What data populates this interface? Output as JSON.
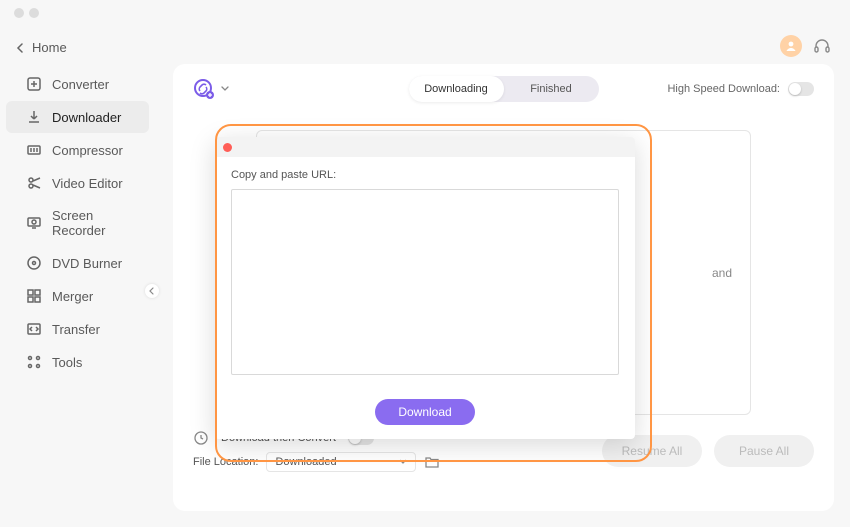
{
  "sidebar": {
    "home_label": "Home",
    "items": [
      {
        "label": "Converter"
      },
      {
        "label": "Downloader"
      },
      {
        "label": "Compressor"
      },
      {
        "label": "Video Editor"
      },
      {
        "label": "Screen Recorder"
      },
      {
        "label": "DVD Burner"
      },
      {
        "label": "Merger"
      },
      {
        "label": "Transfer"
      },
      {
        "label": "Tools"
      }
    ]
  },
  "tabs": {
    "downloading": "Downloading",
    "finished": "Finished"
  },
  "hsd_label": "High Speed Download:",
  "drop_hint_suffix": "and",
  "footer": {
    "download_then_convert": "Download then Convert",
    "file_location_label": "File Location:",
    "file_location_value": "Downloaded",
    "resume_all": "Resume All",
    "pause_all": "Pause All"
  },
  "modal": {
    "label": "Copy and paste URL:",
    "download_btn": "Download"
  }
}
